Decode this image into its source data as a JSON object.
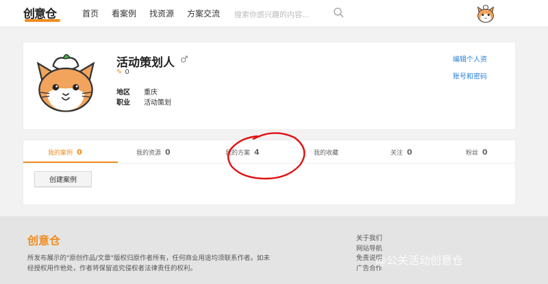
{
  "header": {
    "logo_text": "创意仓",
    "nav": [
      "首页",
      "看案例",
      "找资源",
      "方案交流"
    ],
    "search_placeholder": "搜索你感兴趣的内容..."
  },
  "profile": {
    "name": "活动策划人",
    "gender_symbol": "♂",
    "points": "0",
    "location_label": "地区",
    "location": "重庆",
    "job_label": "职业",
    "job": "活动策划",
    "edit_link": "编辑个人资",
    "account_link": "账号和密码"
  },
  "tabs": [
    {
      "label": "我的案例",
      "count": "0"
    },
    {
      "label": "我的资源",
      "count": "0"
    },
    {
      "label": "我的方案",
      "count": "4"
    },
    {
      "label": "我的收藏",
      "count": ""
    },
    {
      "label": "关注",
      "count": "0"
    },
    {
      "label": "粉丝",
      "count": "0"
    }
  ],
  "create_button": "创建案例",
  "footer": {
    "brand": "创意仓",
    "copyright": "所发布展示的\"原创作品/文章\"版权归原作者所有，任何商业用途均须联系作者。如未经授权用作他处，作者将保留追究侵权者法律责任的权利。",
    "links": [
      "关于我们",
      "网站导航",
      "免责说明",
      "广告合作"
    ],
    "watermark": "@公关活动创意仓"
  },
  "colors": {
    "accent": "#f08c1e",
    "link": "#2a7fd4",
    "annotation": "#e01010"
  }
}
